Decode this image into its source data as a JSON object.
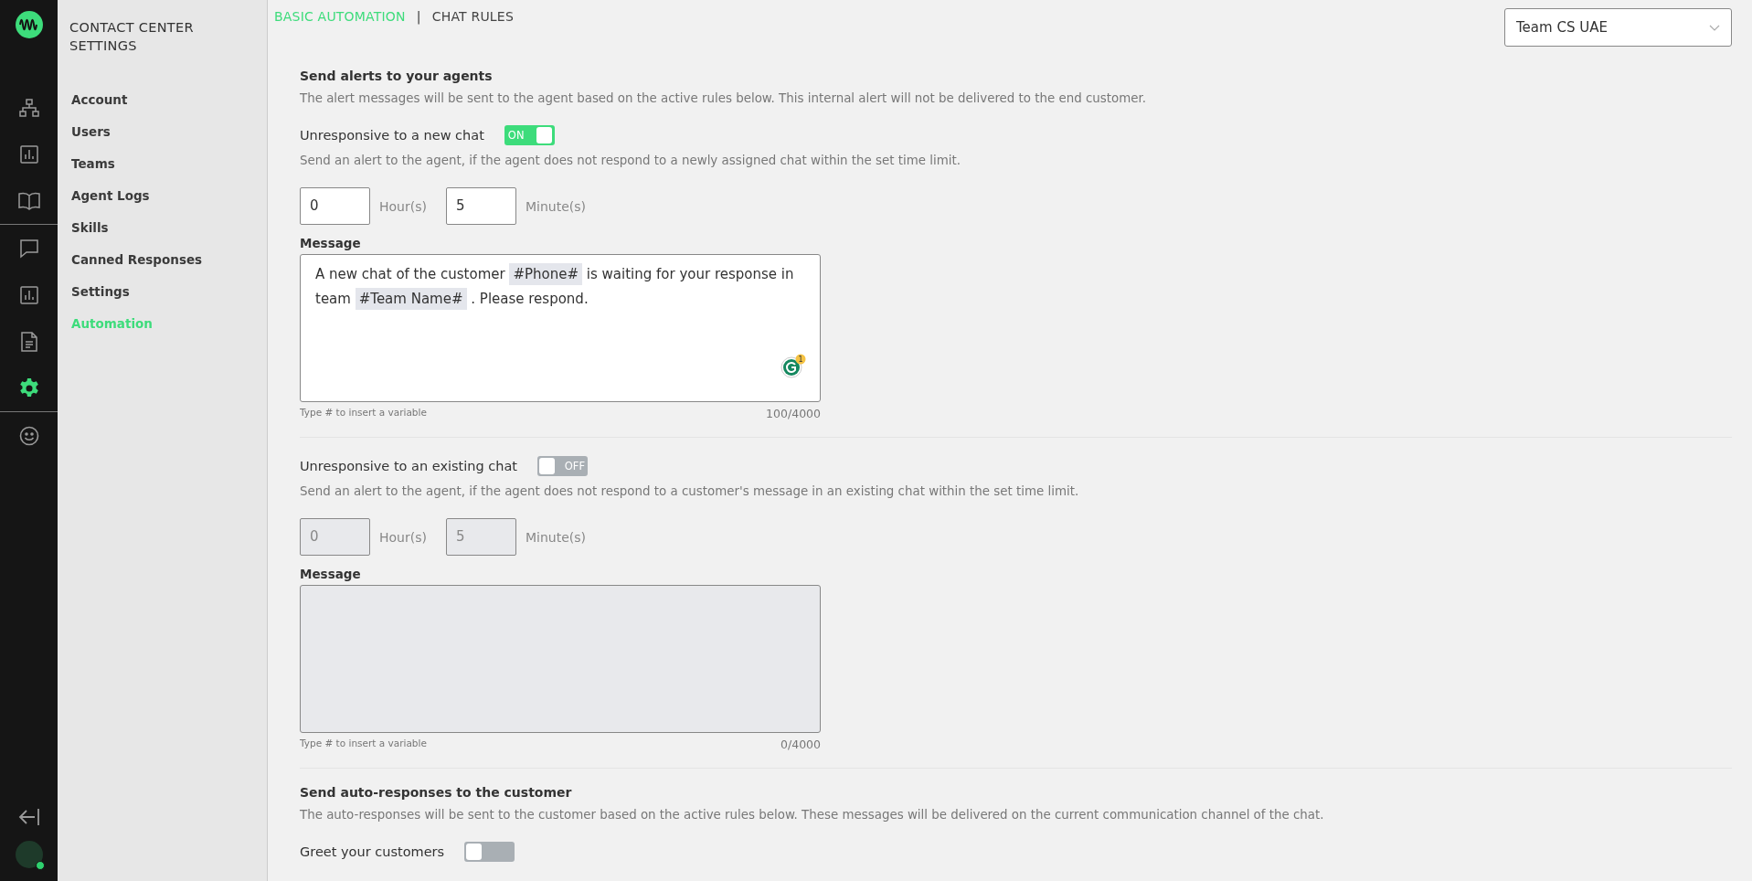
{
  "rail": {
    "top": [
      {
        "selected": false
      },
      {
        "selected": false
      },
      {
        "selected": false
      },
      {
        "selected": false
      },
      {
        "selected": false
      },
      {
        "selected": false
      },
      {
        "selected": true
      },
      {
        "selected": false
      }
    ],
    "avatar": {
      "online": true
    }
  },
  "sidebar": {
    "title": "CONTACT CENTER SETTINGS",
    "items": [
      {
        "label": "Account",
        "selected": false
      },
      {
        "label": "Users",
        "selected": false
      },
      {
        "label": "Teams",
        "selected": false
      },
      {
        "label": "Agent Logs",
        "selected": false
      },
      {
        "label": "Skills",
        "selected": false
      },
      {
        "label": "Canned Responses",
        "selected": false
      },
      {
        "label": "Settings",
        "selected": false
      },
      {
        "label": "Automation",
        "selected": true
      }
    ]
  },
  "breadcrumb": {
    "parent": "BASIC AUTOMATION",
    "separator": "|",
    "current": "CHAT RULES"
  },
  "team_select": {
    "value": "Team CS UAE"
  },
  "sections": [
    {
      "title": "Send alerts to your agents",
      "description": "The alert messages will be sent to the agent based on the active rules below. This internal alert will not be delivered to the end customer.",
      "rules": [
        {
          "label": "Unresponsive to a new chat",
          "toggle": {
            "on": true,
            "text": "ON"
          },
          "description": "Send an alert to the agent, if the agent does not respond to a newly assigned chat within the set time limit.",
          "hours": {
            "value": "0",
            "unit": "Hour(s)"
          },
          "minutes": {
            "value": "5",
            "unit": "Minute(s)"
          },
          "message_label": "Message",
          "message": [
            {
              "kind": "text",
              "text": "A new chat of the customer"
            },
            {
              "kind": "variable",
              "text": "#Phone#"
            },
            {
              "kind": "text",
              "text": "is waiting for your response in team"
            },
            {
              "kind": "variable",
              "text": "#Team Name#"
            },
            {
              "kind": "text",
              "text": ". Please respond."
            }
          ],
          "grammar_badge": "1",
          "hint": "Type # to insert a variable",
          "count": "100/4000"
        },
        {
          "label": "Unresponsive to an existing chat",
          "toggle": {
            "on": false,
            "text": "OFF"
          },
          "description": "Send an alert to the agent, if the agent does not respond to a customer's message in an existing chat within the set time limit.",
          "hours": {
            "value": "0",
            "unit": "Hour(s)"
          },
          "minutes": {
            "value": "5",
            "unit": "Minute(s)"
          },
          "message_label": "Message",
          "hint": "Type # to insert a variable",
          "count": "0/4000"
        }
      ]
    },
    {
      "title": "Send auto-responses to the customer",
      "description": "The auto-responses will be sent to the customer based on the active rules below. These messages will be delivered on the current communication channel of the chat.",
      "rules": [
        {
          "label": "Greet your customers",
          "toggle": {
            "on": false
          }
        }
      ]
    }
  ]
}
